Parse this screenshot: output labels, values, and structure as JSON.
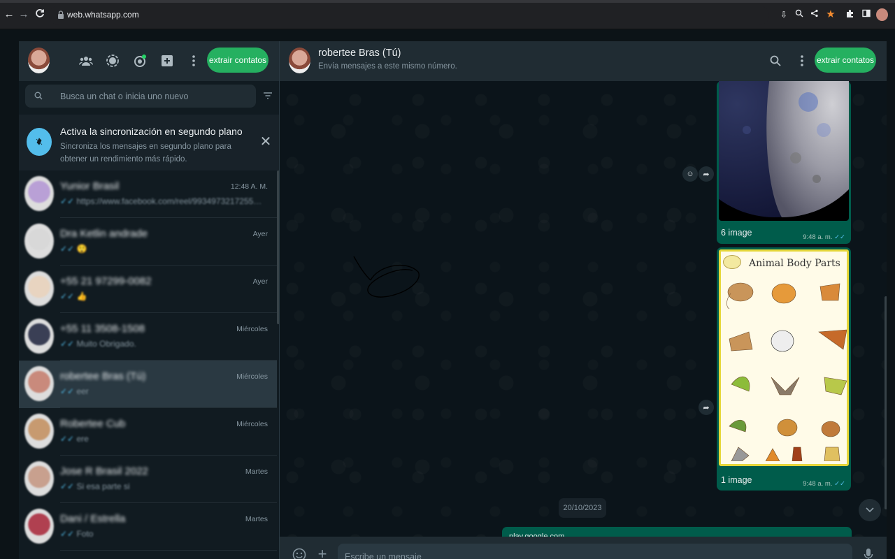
{
  "browser": {
    "url": "web.whatsapp.com"
  },
  "left_header": {
    "extract_button": "extrair contatos"
  },
  "search": {
    "placeholder": "Busca un chat o inicia uno nuevo"
  },
  "sync_banner": {
    "title": "Activa la sincronización en segundo plano",
    "subtitle": "Sincroniza los mensajes en segundo plano para obtener un rendimiento más rápido."
  },
  "chats": [
    {
      "name": "Yunior Brasil",
      "time": "12:48 A. M.",
      "preview": "https://www.facebook.com/reel/993497321725531/?mi...",
      "avatar_color": "#b9a0d6"
    },
    {
      "name": "Dra Ketlin andrade",
      "time": "Ayer",
      "preview": "😲",
      "avatar_color": "#d8d8d8"
    },
    {
      "name": "+55 21 97299-0082",
      "time": "Ayer",
      "preview": "👍",
      "avatar_color": "#e8d4c0"
    },
    {
      "name": "+55 11 3508-1508",
      "time": "Miércoles",
      "preview": "Muito Obrigado.",
      "avatar_color": "#3a3f55"
    },
    {
      "name": "robertee Bras (Tú)",
      "time": "Miércoles",
      "preview": "eer",
      "avatar_color": "#c98a7c",
      "active": true
    },
    {
      "name": "Robertee Cub",
      "time": "Miércoles",
      "preview": "ere",
      "avatar_color": "#c79a70"
    },
    {
      "name": "Jose R Brasil 2022",
      "time": "Martes",
      "preview": "Si esa parte si",
      "avatar_color": "#c8a08e"
    },
    {
      "name": "Dani / Estrella",
      "time": "Martes",
      "preview": "Foto",
      "avatar_color": "#b04050"
    }
  ],
  "conversation": {
    "contact_name": "robertee Bras (Tú)",
    "contact_status": "Envía mensajes a este mismo número.",
    "extract_button": "extrair contatos",
    "messages": [
      {
        "caption": "6 image",
        "time": "9:48 a. m."
      },
      {
        "caption": "1 image",
        "time": "9:48 a. m.",
        "card_title": "Animal Body Parts"
      }
    ],
    "date_separator": "20/10/2023",
    "partial_message": "play.google.com"
  },
  "composer": {
    "placeholder": "Escribe un mensaje"
  },
  "colors": {
    "accent": "#25b060",
    "outgoing_bubble": "#005c4b",
    "panel": "#202c33"
  }
}
